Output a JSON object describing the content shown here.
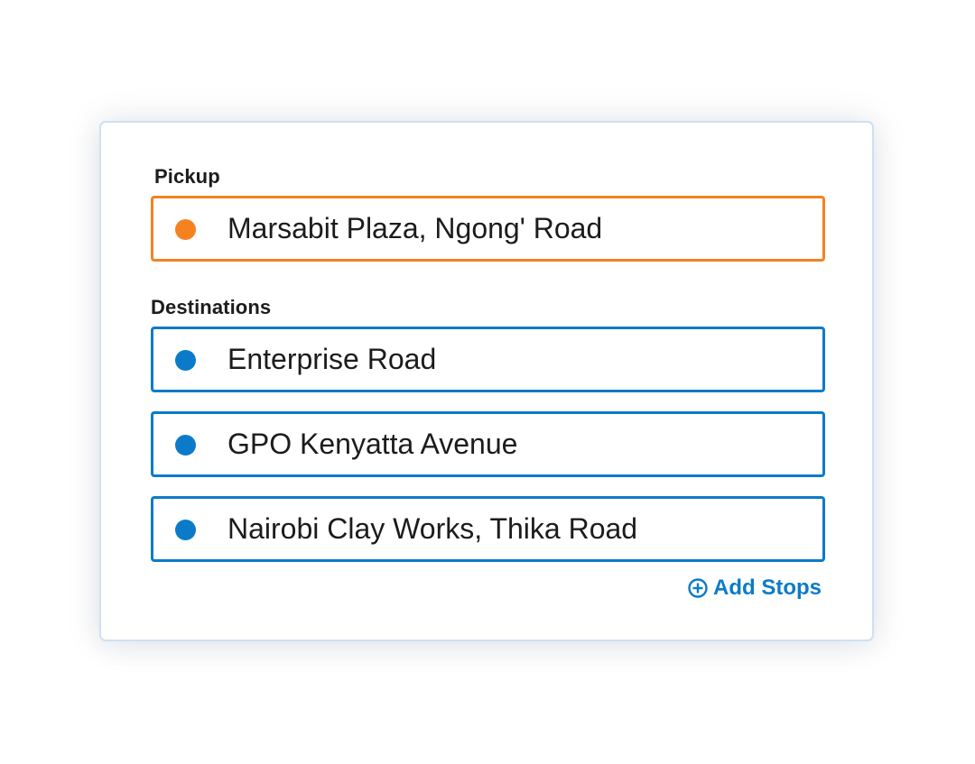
{
  "pickup": {
    "label": "Pickup",
    "value": "Marsabit Plaza, Ngong' Road",
    "color": "#f58220"
  },
  "destinations": {
    "label": "Destinations",
    "color": "#0b7bc9",
    "items": [
      {
        "value": "Enterprise Road"
      },
      {
        "value": "GPO Kenyatta Avenue"
      },
      {
        "value": "Nairobi Clay Works, Thika Road"
      }
    ]
  },
  "add_stops": {
    "label": "Add Stops",
    "icon": "plus-circle-icon"
  }
}
